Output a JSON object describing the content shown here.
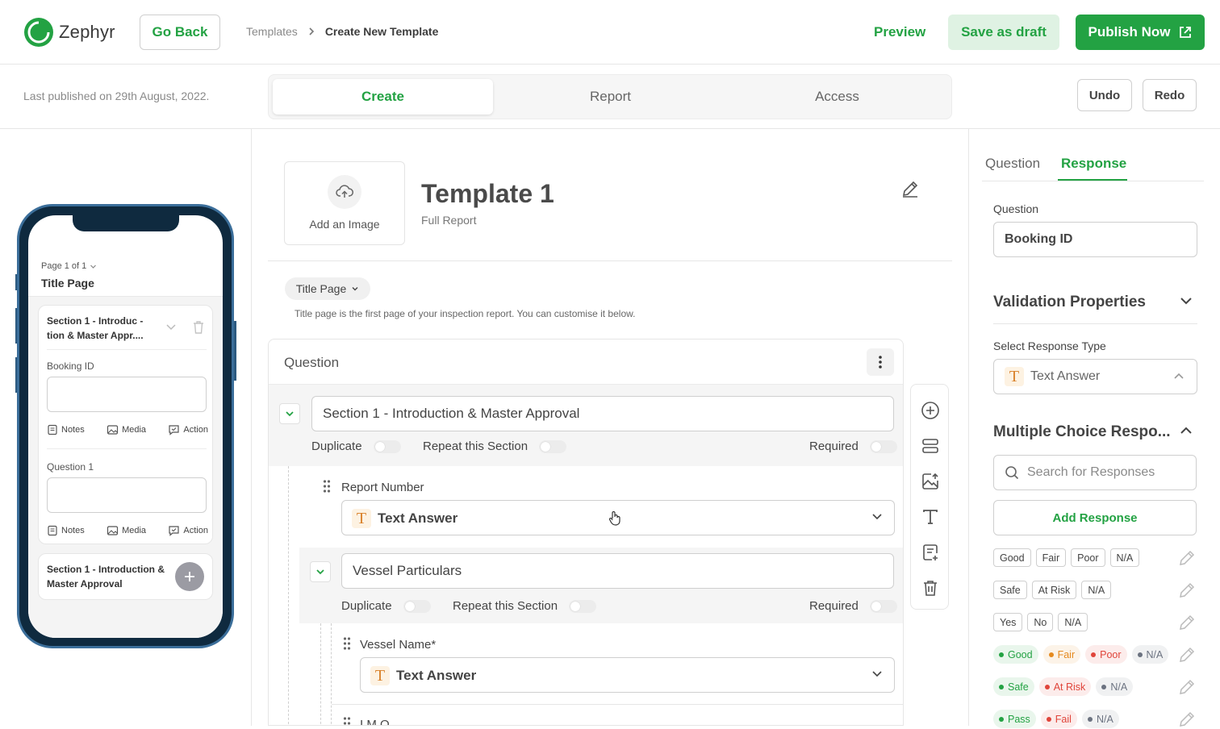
{
  "app": {
    "name": "Zephyr"
  },
  "header": {
    "go_back": "Go Back",
    "breadcrumb": [
      "Templates",
      "Create New Template"
    ],
    "preview": "Preview",
    "save_draft": "Save as draft",
    "publish": "Publish Now"
  },
  "subheader": {
    "last_published": "Last published on 29th August, 2022.",
    "tabs": [
      "Create",
      "Report",
      "Access"
    ],
    "active_tab": "Create",
    "undo": "Undo",
    "redo": "Redo"
  },
  "phone": {
    "page_selector": "Page 1 of 1",
    "page_title": "Title Page",
    "section_title": "Section 1 - Introduc -tion & Master Appr....",
    "questions": [
      {
        "label": "Booking ID",
        "actions": [
          "Notes",
          "Media",
          "Action"
        ]
      },
      {
        "label": "Question 1",
        "actions": [
          "Notes",
          "Media",
          "Action"
        ]
      }
    ],
    "collapsed_section": "Section 1 - Introduction & Master Approval"
  },
  "editor": {
    "add_image": "Add an Image",
    "template_title": "Template 1",
    "template_subtitle": "Full Report",
    "page_pill": "Title Page",
    "page_description": "Title page is the first page of your inspection report. You can customise it below.",
    "card_header": "Question",
    "section1": {
      "title": "Section 1 - Introduction & Master Approval",
      "duplicate": "Duplicate",
      "repeat": "Repeat this Section",
      "required": "Required"
    },
    "question1": {
      "label": "Report Number",
      "type": "Text Answer"
    },
    "section2": {
      "title": "Vessel Particulars",
      "duplicate": "Duplicate",
      "repeat": "Repeat this Section",
      "required": "Required"
    },
    "question2": {
      "label": "Vessel Name*",
      "type": "Text Answer"
    },
    "question3": {
      "label": "I.M.O."
    }
  },
  "toolrail": [
    "add-question-icon",
    "add-section-icon",
    "add-image-icon",
    "add-text-icon",
    "add-note-icon",
    "delete-icon"
  ],
  "panel": {
    "tabs": [
      "Question",
      "Response"
    ],
    "active_tab": "Response",
    "question_label": "Question",
    "question_value": "Booking ID",
    "validation": "Validation Properties",
    "response_type_label": "Select Response Type",
    "response_type_value": "Text Answer",
    "mc_heading": "Multiple Choice Respo...",
    "search_placeholder": "Search for Responses",
    "add_response": "Add Response",
    "plain_sets": [
      [
        "Good",
        "Fair",
        "Poor",
        "N/A"
      ],
      [
        "Safe",
        "At Risk",
        "N/A"
      ],
      [
        "Yes",
        "No",
        "N/A"
      ]
    ],
    "colored_sets": [
      [
        {
          "label": "Good",
          "color": "#23a243"
        },
        {
          "label": "Fair",
          "color": "#e58a1f"
        },
        {
          "label": "Poor",
          "color": "#e0443a"
        },
        {
          "label": "N/A",
          "color": "#6b7280"
        }
      ],
      [
        {
          "label": "Safe",
          "color": "#23a243"
        },
        {
          "label": "At Risk",
          "color": "#e0443a"
        },
        {
          "label": "N/A",
          "color": "#6b7280"
        }
      ],
      [
        {
          "label": "Pass",
          "color": "#23a243"
        },
        {
          "label": "Fail",
          "color": "#e0443a"
        },
        {
          "label": "N/A",
          "color": "#6b7280"
        }
      ]
    ]
  },
  "colors": {
    "accent": "#23a243",
    "accent_light": "#dff2e3"
  }
}
